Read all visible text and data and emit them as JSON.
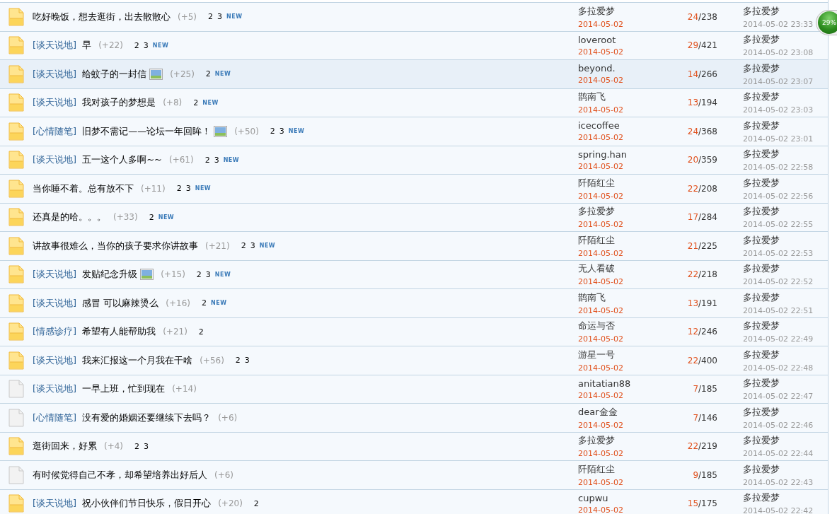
{
  "rows": [
    {
      "hot": true,
      "highlighted": false,
      "title": "吃好晚饭，想去逛街，出去散散心",
      "has_image": false,
      "count": "(+5)",
      "pages": [
        "2",
        "3"
      ],
      "new_badge": "NEW",
      "author": "多拉爱梦",
      "date": "2014-05-02",
      "replies": "24",
      "views": "/238",
      "last_user": "多拉爱梦",
      "last_time": "2014-05-02 23:33"
    },
    {
      "hot": true,
      "highlighted": false,
      "category": "[谈天说地]",
      "title": "早",
      "has_image": false,
      "count": "(+22)",
      "pages": [
        "2",
        "3"
      ],
      "new_badge": "NEW",
      "author": "loveroot",
      "date": "2014-05-02",
      "replies": "29",
      "views": "/421",
      "last_user": "多拉爱梦",
      "last_time": "2014-05-02 23:08"
    },
    {
      "hot": true,
      "highlighted": true,
      "category": "[谈天说地]",
      "title": "给蚊子的一封信",
      "has_image": true,
      "count": "(+25)",
      "pages": [
        "2"
      ],
      "new_badge": "NEW",
      "author": "beyond.",
      "date": "2014-05-02",
      "replies": "14",
      "views": "/266",
      "last_user": "多拉爱梦",
      "last_time": "2014-05-02 23:07"
    },
    {
      "hot": true,
      "highlighted": false,
      "category": "[谈天说地]",
      "title": "我对孩子的梦想是",
      "has_image": false,
      "count": "(+8)",
      "pages": [
        "2"
      ],
      "new_badge": "NEW",
      "author": "鹊南飞",
      "date": "2014-05-02",
      "replies": "13",
      "views": "/194",
      "last_user": "多拉爱梦",
      "last_time": "2014-05-02 23:03"
    },
    {
      "hot": true,
      "highlighted": false,
      "category": "[心情随笔]",
      "title": "旧梦不需记——论坛一年回眸！",
      "has_image": true,
      "count": "(+50)",
      "pages": [
        "2",
        "3"
      ],
      "new_badge": "NEW",
      "author": "icecoffee",
      "date": "2014-05-02",
      "replies": "24",
      "views": "/368",
      "last_user": "多拉爱梦",
      "last_time": "2014-05-02 23:01"
    },
    {
      "hot": true,
      "highlighted": false,
      "category": "[谈天说地]",
      "title": "五一这个人多啊~~",
      "has_image": false,
      "count": "(+61)",
      "pages": [
        "2",
        "3"
      ],
      "new_badge": "NEW",
      "author": "spring.han",
      "date": "2014-05-02",
      "replies": "20",
      "views": "/359",
      "last_user": "多拉爱梦",
      "last_time": "2014-05-02 22:58"
    },
    {
      "hot": true,
      "highlighted": false,
      "title": "当你睡不着。总有放不下",
      "has_image": false,
      "count": "(+11)",
      "pages": [
        "2",
        "3"
      ],
      "new_badge": "NEW",
      "author": "阡陌红尘",
      "date": "2014-05-02",
      "replies": "22",
      "views": "/208",
      "last_user": "多拉爱梦",
      "last_time": "2014-05-02 22:56"
    },
    {
      "hot": true,
      "highlighted": false,
      "title": "还真是的哈。。。",
      "has_image": false,
      "count": "(+33)",
      "pages": [
        "2"
      ],
      "new_badge": "NEW",
      "author": "多拉爱梦",
      "date": "2014-05-02",
      "replies": "17",
      "views": "/284",
      "last_user": "多拉爱梦",
      "last_time": "2014-05-02 22:55"
    },
    {
      "hot": true,
      "highlighted": false,
      "title": "讲故事很难么，当你的孩子要求你讲故事",
      "has_image": false,
      "count": "(+21)",
      "pages": [
        "2",
        "3"
      ],
      "new_badge": "NEW",
      "author": "阡陌红尘",
      "date": "2014-05-02",
      "replies": "21",
      "views": "/225",
      "last_user": "多拉爱梦",
      "last_time": "2014-05-02 22:53"
    },
    {
      "hot": true,
      "highlighted": false,
      "category": "[谈天说地]",
      "title": "发贴纪念升级",
      "has_image": true,
      "count": "(+15)",
      "pages": [
        "2",
        "3"
      ],
      "new_badge": "NEW",
      "author": "无人看破",
      "date": "2014-05-02",
      "replies": "22",
      "views": "/218",
      "last_user": "多拉爱梦",
      "last_time": "2014-05-02 22:52"
    },
    {
      "hot": true,
      "highlighted": false,
      "category": "[谈天说地]",
      "title": "感冒 可以麻辣烫么",
      "has_image": false,
      "count": "(+16)",
      "pages": [
        "2"
      ],
      "new_badge": "NEW",
      "author": "鹊南飞",
      "date": "2014-05-02",
      "replies": "13",
      "views": "/191",
      "last_user": "多拉爱梦",
      "last_time": "2014-05-02 22:51"
    },
    {
      "hot": true,
      "highlighted": false,
      "category": "[情感诊疗]",
      "title": "希望有人能帮助我",
      "has_image": false,
      "count": "(+21)",
      "pages": [
        "2"
      ],
      "author": "命运与否",
      "date": "2014-05-02",
      "replies": "12",
      "views": "/246",
      "last_user": "多拉爱梦",
      "last_time": "2014-05-02 22:49"
    },
    {
      "hot": true,
      "highlighted": false,
      "category": "[谈天说地]",
      "title": "我来汇报这一个月我在干啥",
      "has_image": false,
      "count": "(+56)",
      "pages": [
        "2",
        "3"
      ],
      "author": "游星一号",
      "date": "2014-05-02",
      "replies": "22",
      "views": "/400",
      "last_user": "多拉爱梦",
      "last_time": "2014-05-02 22:48"
    },
    {
      "hot": false,
      "highlighted": false,
      "category": "[谈天说地]",
      "title": "一早上班，忙到现在",
      "has_image": false,
      "count": "(+14)",
      "author": "anitatian88",
      "date": "2014-05-02",
      "replies": "7",
      "views": "/185",
      "last_user": "多拉爱梦",
      "last_time": "2014-05-02 22:47"
    },
    {
      "hot": false,
      "highlighted": false,
      "category": "[心情随笔]",
      "title": "没有爱的婚姻还要继续下去吗？",
      "has_image": false,
      "count": "(+6)",
      "author": "dear金金",
      "date": "2014-05-02",
      "replies": "7",
      "views": "/146",
      "last_user": "多拉爱梦",
      "last_time": "2014-05-02 22:46"
    },
    {
      "hot": true,
      "highlighted": false,
      "title": "逛街回来，好累",
      "has_image": false,
      "count": "(+4)",
      "pages": [
        "2",
        "3"
      ],
      "author": "多拉爱梦",
      "date": "2014-05-02",
      "replies": "22",
      "views": "/219",
      "last_user": "多拉爱梦",
      "last_time": "2014-05-02 22:44"
    },
    {
      "hot": false,
      "highlighted": false,
      "title": "有时候觉得自己不孝，却希望培养出好后人",
      "has_image": false,
      "count": "(+6)",
      "author": "阡陌红尘",
      "date": "2014-05-02",
      "replies": "9",
      "views": "/185",
      "last_user": "多拉爱梦",
      "last_time": "2014-05-02 22:43"
    },
    {
      "hot": true,
      "highlighted": false,
      "category": "[谈天说地]",
      "title": "祝小伙伴们节日快乐，假日开心",
      "has_image": false,
      "count": "(+20)",
      "pages": [
        "2"
      ],
      "author": "cupwu",
      "date": "2014-05-02",
      "replies": "15",
      "views": "/175",
      "last_user": "多拉爱梦",
      "last_time": "2014-05-02 22:42"
    }
  ],
  "speed_widget": {
    "label": "29%"
  }
}
